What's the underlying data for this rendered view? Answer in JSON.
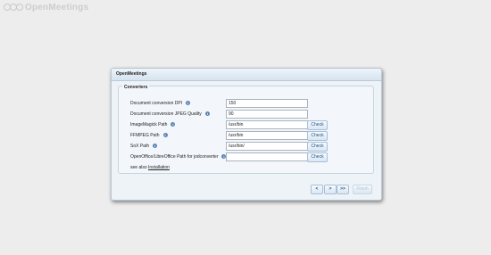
{
  "app": {
    "logo_text": "OpenMeetings"
  },
  "dialog": {
    "title": "OpenMeetings",
    "section_title": "Converters",
    "rows": [
      {
        "label": "Document conversion DPI",
        "value": "150",
        "check": null
      },
      {
        "label": "Document conversion JPEG Quality",
        "value": "90",
        "check": null
      },
      {
        "label": "ImageMagick Path",
        "value": "/usr/bin",
        "check": "Check"
      },
      {
        "label": "FFMPEG Path",
        "value": "/usr/bin",
        "check": "Check"
      },
      {
        "label": "SoX Path",
        "value": "/usr/bin/",
        "check": "Check"
      },
      {
        "label": "OpenOffice/LibreOffice Path for jodconverter",
        "value": "",
        "check": "Check"
      }
    ],
    "see_also_text": "see also",
    "see_also_link": "Installation",
    "nav": {
      "prev": "<",
      "next": ">",
      "last": ">>",
      "finish": "Finish"
    }
  }
}
